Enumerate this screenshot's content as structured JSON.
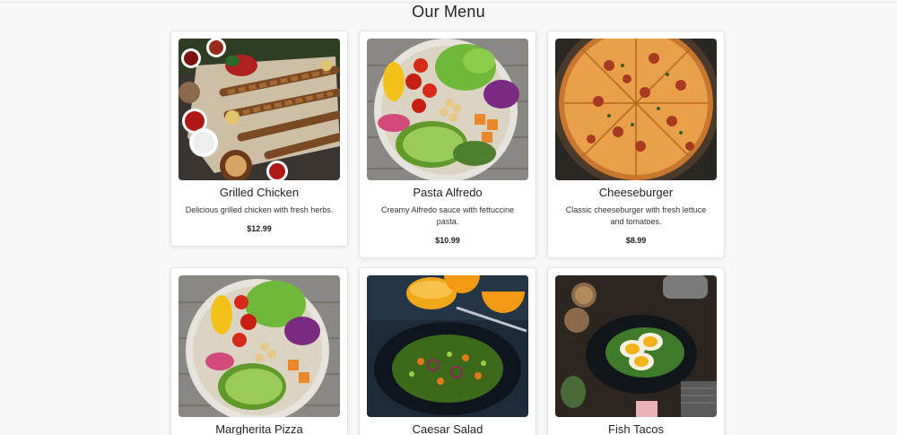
{
  "page": {
    "title": "Our Menu"
  },
  "menu": {
    "items": [
      {
        "name": "Grilled Chicken",
        "description": "Delicious grilled chicken with fresh herbs.",
        "price": "$12.99",
        "image": "grilled-skewers-platter"
      },
      {
        "name": "Pasta Alfredo",
        "description": "Creamy Alfredo sauce with fettuccine pasta.",
        "price": "$10.99",
        "image": "avocado-salad-bowl"
      },
      {
        "name": "Cheeseburger",
        "description": "Classic cheeseburger with fresh lettuce and tomatoes.",
        "price": "$8.99",
        "image": "pizza-in-pan"
      },
      {
        "name": "Margherita Pizza",
        "description": "",
        "price": "",
        "image": "avocado-salad-bowl"
      },
      {
        "name": "Caesar Salad",
        "description": "",
        "price": "",
        "image": "salad-plate-orange-juice"
      },
      {
        "name": "Fish Tacos",
        "description": "",
        "price": "",
        "image": "egg-salad-plate"
      }
    ]
  },
  "colors": {
    "background": "#f7f7f8",
    "card": "#ffffff",
    "text": "#222222"
  }
}
